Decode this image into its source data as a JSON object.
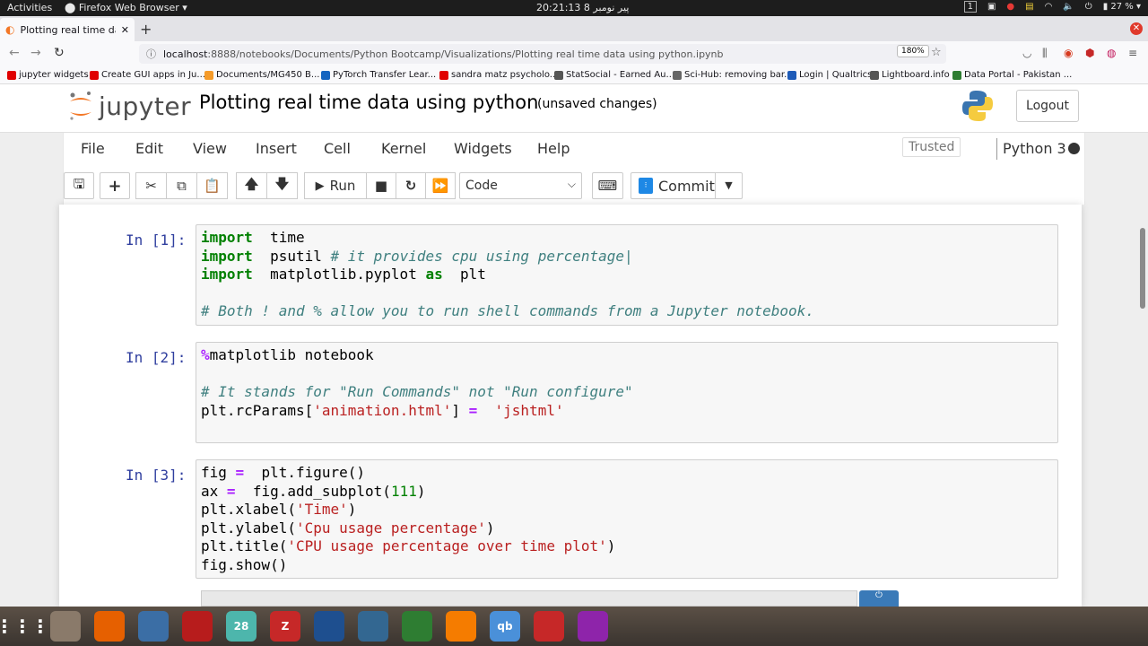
{
  "system_bar": {
    "activities": "Activities",
    "app_name": "Firefox Web Browser ▾",
    "clock": "20:21:13  پیر نومبر 8",
    "workspace": "1",
    "battery": "27 %"
  },
  "browser": {
    "tab_title": "Plotting real time data u",
    "new_tab": "+",
    "url_host": "localhost",
    "url_path": ":8888/notebooks/Documents/Python Bootcamp/Visualizations/Plotting real time data using python.ipynb",
    "zoom": "180%",
    "bookmarks": [
      {
        "label": "jupyter widgets",
        "color": "#e00000"
      },
      {
        "label": "Create GUI apps in Ju...",
        "color": "#e00000"
      },
      {
        "label": "Documents/MG450 B...",
        "color": "#f59b2a"
      },
      {
        "label": "PyTorch Transfer Lear...",
        "color": "#1565c0"
      },
      {
        "label": "sandra matz psycholo...",
        "color": "#e00000"
      },
      {
        "label": "StatSocial - Earned Au...",
        "color": "#555555"
      },
      {
        "label": "Sci-Hub: removing bar...",
        "color": "#666666"
      },
      {
        "label": "Login | Qualtrics",
        "color": "#1e5bb8"
      },
      {
        "label": "Lightboard.info",
        "color": "#555555"
      },
      {
        "label": "Data Portal - Pakistan ...",
        "color": "#2e7d32"
      }
    ]
  },
  "jupyter": {
    "logo_text": "jupyter",
    "notebook_title": "Plotting real time data using python",
    "save_status": "(unsaved changes)",
    "logout": "Logout",
    "menu": [
      "File",
      "Edit",
      "View",
      "Insert",
      "Cell",
      "Kernel",
      "Widgets",
      "Help"
    ],
    "trusted": "Trusted",
    "kernel_name": "Python 3",
    "toolbar": {
      "run": "Run",
      "cell_type": "Code",
      "commit": "Commit"
    }
  },
  "cells": [
    {
      "prompt": "In [1]:",
      "lines": [
        [
          [
            "kw",
            "import"
          ],
          [
            "",
            "  time"
          ]
        ],
        [
          [
            "kw",
            "import"
          ],
          [
            "",
            "  psutil "
          ],
          [
            "cm",
            "# it provides cpu using percentage|"
          ]
        ],
        [
          [
            "kw",
            "import"
          ],
          [
            "",
            "  matplotlib.pyplot "
          ],
          [
            "kw",
            "as"
          ],
          [
            "",
            "  plt"
          ]
        ],
        [],
        [
          [
            "cm",
            "# Both ! and % allow you to run shell commands from a Jupyter notebook."
          ]
        ]
      ]
    },
    {
      "prompt": "In [2]:",
      "lines": [
        [
          [
            "op",
            "%"
          ],
          [
            "",
            "matplotlib notebook"
          ]
        ],
        [],
        [
          [
            "cm",
            "# It stands for \"Run Commands\" not \"Run configure\""
          ]
        ],
        [
          [
            "",
            "plt.rcParams["
          ],
          [
            "st",
            "'animation.html'"
          ],
          [
            "",
            "] "
          ],
          [
            "op",
            "="
          ],
          [
            "",
            "  "
          ],
          [
            "st",
            "'jshtml'"
          ]
        ],
        []
      ]
    },
    {
      "prompt": "In [3]:",
      "lines": [
        [
          [
            "",
            "fig "
          ],
          [
            "op",
            "="
          ],
          [
            "",
            "  plt.figure()"
          ]
        ],
        [
          [
            "",
            "ax "
          ],
          [
            "op",
            "="
          ],
          [
            "",
            "  fig.add_subplot("
          ],
          [
            "nu",
            "111"
          ],
          [
            "",
            ")"
          ]
        ],
        [
          [
            "",
            "plt.xlabel("
          ],
          [
            "st",
            "'Time'"
          ],
          [
            "",
            ")"
          ]
        ],
        [
          [
            "",
            "plt.ylabel("
          ],
          [
            "st",
            "'Cpu usage percentage'"
          ],
          [
            "",
            ")"
          ]
        ],
        [
          [
            "",
            "plt.title("
          ],
          [
            "st",
            "'CPU usage percentage over time plot'"
          ],
          [
            "",
            ")"
          ]
        ],
        [
          [
            "",
            "fig.show()"
          ]
        ]
      ]
    }
  ],
  "dock": [
    {
      "name": "files-icon",
      "color": "#8a7a6a",
      "glyph": ""
    },
    {
      "name": "firefox-icon",
      "color": "#e66000",
      "glyph": ""
    },
    {
      "name": "text-editor-icon",
      "color": "#3b6ea5",
      "glyph": ""
    },
    {
      "name": "screen-recorder-icon",
      "color": "#b71c1c",
      "glyph": ""
    },
    {
      "name": "calendar-icon",
      "color": "#4db6ac",
      "glyph": "28"
    },
    {
      "name": "filezilla-icon",
      "color": "#c62828",
      "glyph": "Z"
    },
    {
      "name": "virtualbox-icon",
      "color": "#1e4f8f",
      "glyph": ""
    },
    {
      "name": "postgresql-icon",
      "color": "#336791",
      "glyph": ""
    },
    {
      "name": "spreadsheet-icon",
      "color": "#2e7d32",
      "glyph": ""
    },
    {
      "name": "vlc-icon",
      "color": "#f57c00",
      "glyph": ""
    },
    {
      "name": "qbittorrent-icon",
      "color": "#4a90d9",
      "glyph": "qb"
    },
    {
      "name": "document-viewer-icon",
      "color": "#c62828",
      "glyph": ""
    },
    {
      "name": "media-player-icon",
      "color": "#8e24aa",
      "glyph": ""
    }
  ]
}
